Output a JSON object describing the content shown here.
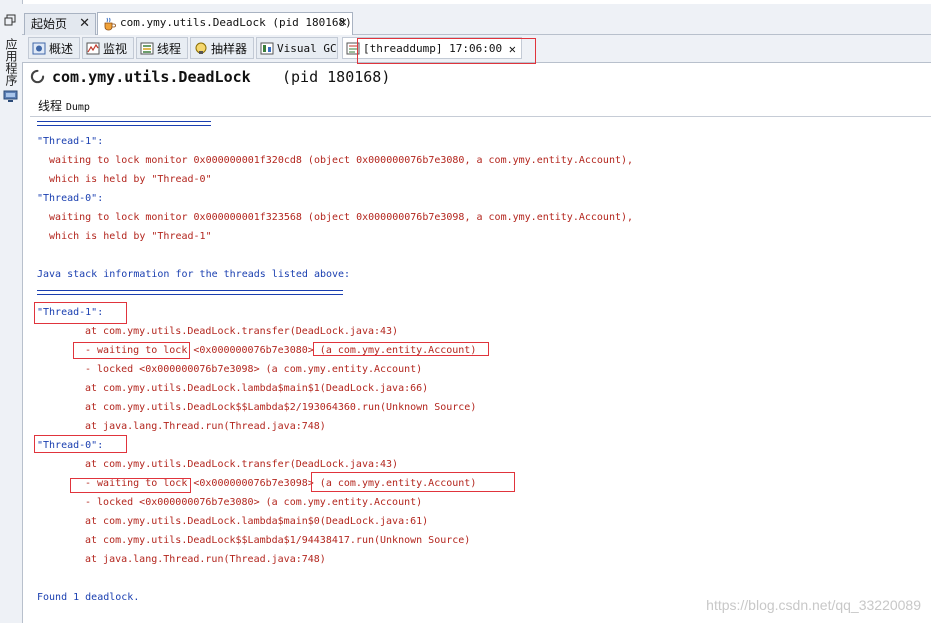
{
  "sidebar": {
    "label": "应用程序"
  },
  "editor_tabs": [
    {
      "label": "起始页"
    },
    {
      "label": "com.ymy.utils.DeadLock (pid 180168)"
    }
  ],
  "sub_tabs": [
    {
      "label": "概述"
    },
    {
      "label": "监视"
    },
    {
      "label": "线程"
    },
    {
      "label": "抽样器"
    },
    {
      "label": "Visual GC"
    },
    {
      "label": "[threaddump] 17:06:00"
    }
  ],
  "close_glyph": "✕",
  "title": {
    "name": "com.ymy.utils.DeadLock",
    "pid": "(pid 180168)"
  },
  "section": {
    "label_cn": "线程",
    "label_en": "Dump"
  },
  "dump": {
    "header_lines": [
      "\"Thread-1\":",
      "  waiting to lock monitor 0x000000001f320cd8 (object 0x000000076b7e3080, a com.ymy.entity.Account),",
      "  which is held by \"Thread-0\"",
      "\"Thread-0\":",
      "  waiting to lock monitor 0x000000001f323568 (object 0x000000076b7e3098, a com.ymy.entity.Account),",
      "  which is held by \"Thread-1\""
    ],
    "stack_header": "Java stack information for the threads listed above:",
    "thread1_name": "\"Thread-1\":",
    "thread1_frames": [
      "at com.ymy.utils.DeadLock.transfer(DeadLock.java:43)",
      "- waiting to lock <0x000000076b7e3080> (a com.ymy.entity.Account)",
      "- locked <0x000000076b7e3098> (a com.ymy.entity.Account)",
      "at com.ymy.utils.DeadLock.lambda$main$1(DeadLock.java:66)",
      "at com.ymy.utils.DeadLock$$Lambda$2/193064360.run(Unknown Source)",
      "at java.lang.Thread.run(Thread.java:748)"
    ],
    "thread0_name": "\"Thread-0\":",
    "thread0_frames": [
      "at com.ymy.utils.DeadLock.transfer(DeadLock.java:43)",
      "- waiting to lock <0x000000076b7e3098> (a com.ymy.entity.Account)",
      "- locked <0x000000076b7e3080> (a com.ymy.entity.Account)",
      "at com.ymy.utils.DeadLock.lambda$main$0(DeadLock.java:61)",
      "at com.ymy.utils.DeadLock$$Lambda$1/94438417.run(Unknown Source)",
      "at java.lang.Thread.run(Thread.java:748)"
    ],
    "footer": "Found 1 deadlock."
  },
  "watermark": "https://blog.csdn.net/qq_33220089",
  "colors": {
    "thread_name": "#1a3fb0",
    "stack_text": "#b3261e",
    "highlight_box": "#e0343c"
  }
}
